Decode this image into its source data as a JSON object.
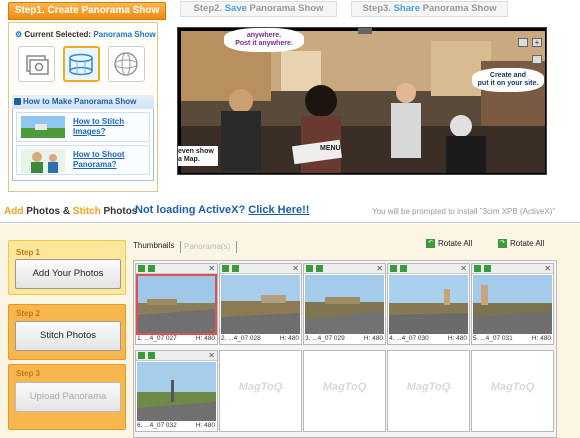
{
  "tabs": {
    "step1": "Step1. Create Panorama Show",
    "step2_prefix": "Step2.",
    "step2_hl": "Save",
    "step2_rest": "Panorama Show",
    "step3_prefix": "Step3.",
    "step3_hl": "Share",
    "step3_rest": "Panorama Show"
  },
  "current_selected": {
    "label": "Current Selected:",
    "value": "Panorama Show"
  },
  "howto": {
    "title": "How to Make Panorama Show",
    "items": [
      {
        "line1": "How to Stitch",
        "line2": "Images?"
      },
      {
        "line1": "How to Shoot",
        "line2": "Panorama?"
      }
    ]
  },
  "viewer": {
    "bubble_top": "anywhere.\nPost it anywhere.",
    "bubble_right": "Create and\nput it on your site.",
    "bubble_left": "even show\na Map.",
    "menu_sign": "MENU"
  },
  "addbar": {
    "add": "Add",
    "photos1": "Photos",
    "amp": "&",
    "stitch": "Stitch",
    "photos2": "Photos",
    "noactivex": "Not loading ActiveX?",
    "clickhere": "Click Here!!",
    "prompt": "You will be prompted to install \"3cim XPB (ActiveX)\""
  },
  "steps": [
    {
      "label": "Step 1",
      "button": "Add Your Photos"
    },
    {
      "label": "Step 2",
      "button": "Stitch Photos"
    },
    {
      "label": "Step 3",
      "button": "Upload Panorama"
    }
  ],
  "thumbs_tabs": {
    "thumbnails": "Thumbnails",
    "panoramas": "Panorama(s)"
  },
  "rotate_all": "Rotate All",
  "thumbnails": [
    {
      "caption": "1. ...4_07 027",
      "height": "H: 480"
    },
    {
      "caption": "2. ...4_07 028",
      "height": "H: 480"
    },
    {
      "caption": "3. ...4_07 029",
      "height": "H: 480"
    },
    {
      "caption": "4. ...4_07 030",
      "height": "H: 480"
    },
    {
      "caption": "5. ...4_07 031",
      "height": "H: 480"
    },
    {
      "caption": "6. ...4_07 032",
      "height": "H: 480"
    }
  ],
  "watermark": "MagToQ"
}
